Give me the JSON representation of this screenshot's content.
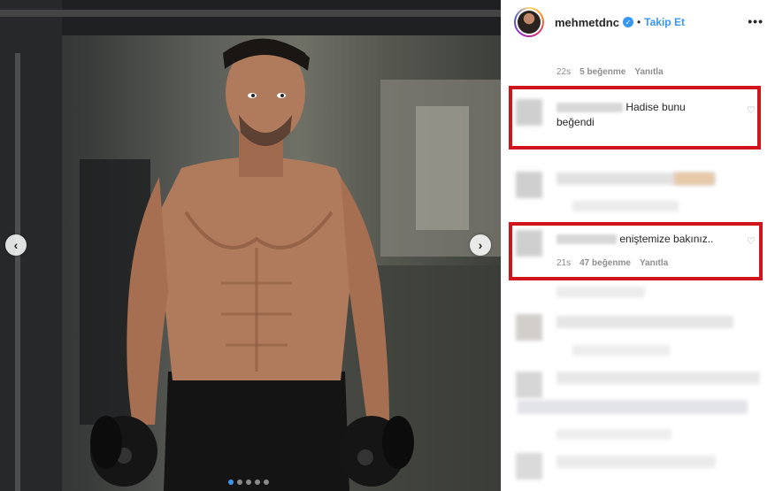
{
  "header": {
    "username": "mehmetdnc",
    "separator": "•",
    "follow_label": "Takip Et",
    "more_label": "•••"
  },
  "comments": [
    {
      "time": "22s",
      "likes": "5 beğenme",
      "reply": "Yanıtla"
    },
    {
      "text_line1": "Hadise bunu",
      "text_line2": "beğendi"
    },
    {
      "text": "eniştemize bakınız..",
      "time": "21s",
      "likes": "47 beğenme",
      "reply": "Yanıtla"
    }
  ],
  "colors": {
    "highlight": "#d0141c",
    "link": "#3897f0"
  },
  "icons": {
    "nav_left": "‹",
    "nav_right": "›",
    "verified": "✓",
    "heart": "♡"
  }
}
